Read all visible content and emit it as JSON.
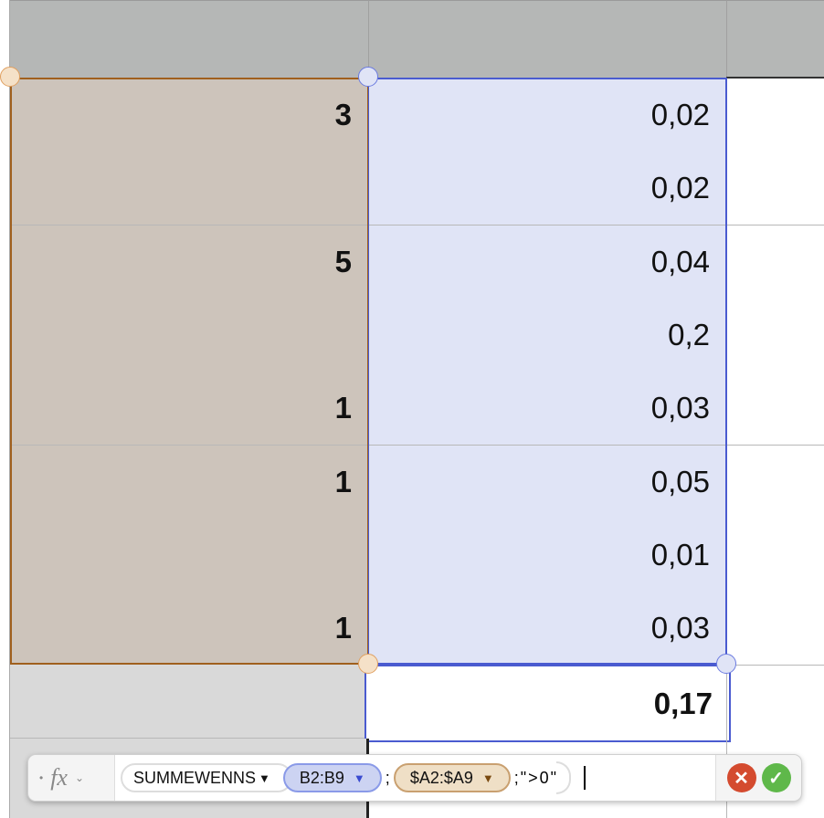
{
  "column_a": [
    "3",
    "",
    "5",
    "",
    "1",
    "1",
    "",
    "1"
  ],
  "column_b": [
    "0,02",
    "0,02",
    "0,04",
    "0,2",
    "0,03",
    "0,05",
    "0,01",
    "0,03"
  ],
  "total": "0,17",
  "formula_bar": {
    "fx_label": "fx",
    "function_name": "SUMMEWENNS",
    "arg1": "B2:B9",
    "sep1": ";",
    "arg2": "$A2:$A9",
    "rest": ";\">0\"",
    "cancel_icon": "x-circle-icon",
    "accept_icon": "check-circle-icon"
  },
  "colors": {
    "range_a": "#a0601e",
    "range_b": "#4a5bd0",
    "cancel": "#d44b2f",
    "accept": "#5fb84a"
  }
}
